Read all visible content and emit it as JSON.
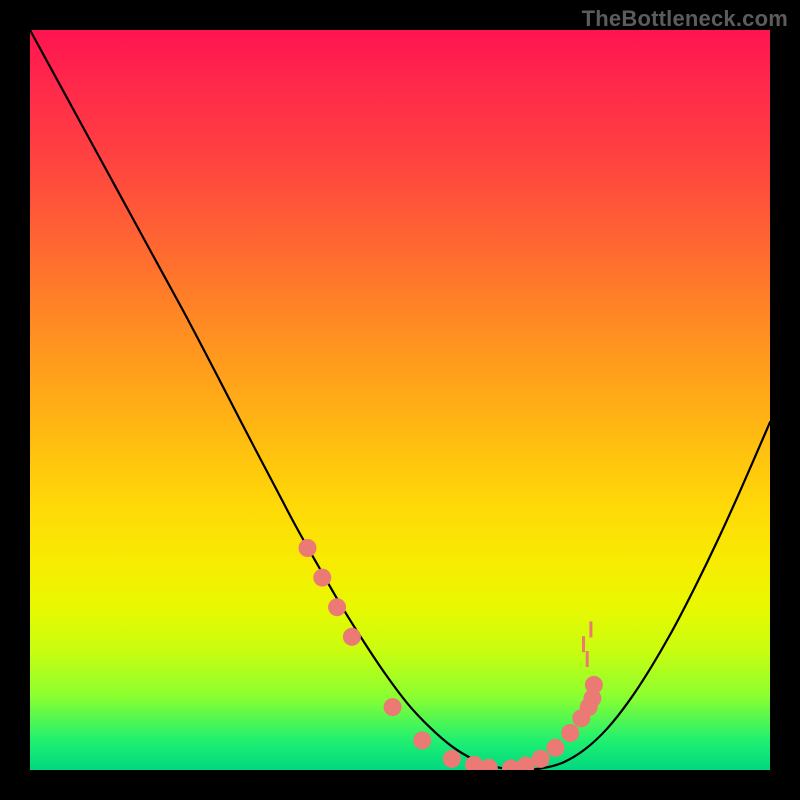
{
  "watermark": "TheBottleneck.com",
  "chart_data": {
    "type": "line",
    "title": "",
    "xlabel": "",
    "ylabel": "",
    "xlim": [
      0,
      100
    ],
    "ylim": [
      0,
      100
    ],
    "curve_x": [
      0,
      3,
      6,
      9,
      12,
      15,
      18,
      21,
      24,
      27,
      30,
      33,
      36,
      39,
      42,
      45,
      48,
      51,
      54,
      57,
      60,
      63,
      66,
      69,
      72,
      75,
      78,
      81,
      84,
      87,
      90,
      93,
      96,
      100
    ],
    "curve_y": [
      100,
      94.5,
      89,
      83.5,
      78,
      72.5,
      67,
      61.5,
      55.8,
      50,
      44.2,
      38.5,
      32.8,
      27.5,
      22.3,
      17.5,
      13,
      9,
      5.8,
      3.2,
      1.4,
      0.4,
      0.05,
      0.2,
      1,
      2.8,
      5.6,
      9.4,
      14,
      19.2,
      25,
      31.2,
      37.8,
      47
    ],
    "markers": [
      {
        "x": 37.5,
        "y": 30
      },
      {
        "x": 39.5,
        "y": 26
      },
      {
        "x": 41.5,
        "y": 22
      },
      {
        "x": 43.5,
        "y": 18
      },
      {
        "x": 49,
        "y": 8.5
      },
      {
        "x": 53,
        "y": 4
      },
      {
        "x": 57,
        "y": 1.5
      },
      {
        "x": 60,
        "y": 0.7
      },
      {
        "x": 62,
        "y": 0.3
      },
      {
        "x": 65,
        "y": 0.2
      },
      {
        "x": 67,
        "y": 0.6
      },
      {
        "x": 69,
        "y": 1.5
      },
      {
        "x": 71,
        "y": 3
      },
      {
        "x": 73,
        "y": 5
      },
      {
        "x": 74.5,
        "y": 7
      },
      {
        "x": 75.5,
        "y": 8.5
      },
      {
        "x": 76,
        "y": 9.7
      },
      {
        "x": 76.2,
        "y": 11.5
      }
    ],
    "minor_markers": [
      {
        "x": 75.3,
        "y": 15
      },
      {
        "x": 74.8,
        "y": 17
      },
      {
        "x": 75.8,
        "y": 19
      }
    ],
    "gradient_stops": [
      {
        "pos": 0,
        "color": "#ff1450"
      },
      {
        "pos": 100,
        "color": "#00d880"
      }
    ]
  }
}
